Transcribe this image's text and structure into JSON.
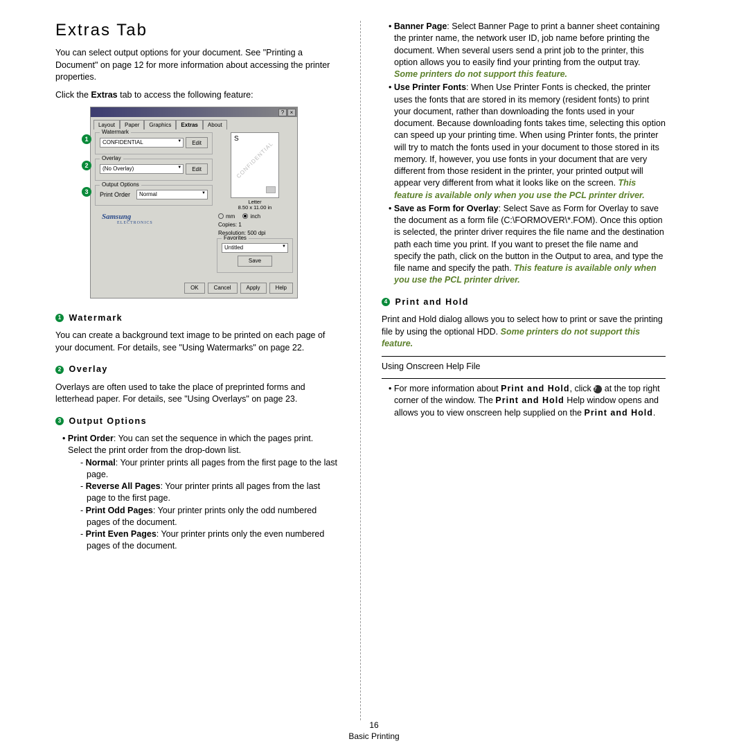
{
  "page": {
    "number": "16",
    "section": "Basic Printing"
  },
  "left": {
    "title": "Extras Tab",
    "intro": "You can select output options for your document. See \"Printing a Document\" on page 12 for more information about accessing the printer properties.",
    "click_line_pre": "Click the ",
    "click_line_bold": "Extras",
    "click_line_post": " tab to access the following feature:",
    "dialog": {
      "tabs": {
        "layout": "Layout",
        "paper": "Paper",
        "graphics": "Graphics",
        "extras": "Extras",
        "about": "About"
      },
      "watermark": {
        "legend": "Watermark",
        "value": "CONFIDENTIAL",
        "edit": "Edit"
      },
      "overlay": {
        "legend": "Overlay",
        "value": "(No Overlay)",
        "edit": "Edit"
      },
      "output": {
        "legend": "Output Options",
        "label": "Print Order",
        "value": "Normal"
      },
      "preview": {
        "wm": "CONFIDENTIAL",
        "s": "S",
        "label1": "Letter",
        "label2": "8.50 x 11.00 in"
      },
      "units": {
        "mm": "mm",
        "inch": "inch"
      },
      "info": {
        "copies": "Copies: 1",
        "res": "Resolution: 500 dpi"
      },
      "fav": {
        "legend": "Favorites",
        "value": "Untitled",
        "save": "Save"
      },
      "brand": "Samsung",
      "brand_sub": "ELECTRONICS",
      "buttons": {
        "ok": "OK",
        "cancel": "Cancel",
        "apply": "Apply",
        "help": "Help"
      },
      "titlebar": {
        "help": "?",
        "close": "×"
      }
    },
    "sect_watermark": {
      "num": "1",
      "label": "Watermark",
      "text": "You can create a background text image to be printed on each page of your document. For details, see \"Using Watermarks\" on page 22."
    },
    "sect_overlay": {
      "num": "2",
      "label": "Overlay",
      "text": "Overlays are often used to take the place of preprinted forms and letterhead paper. For details, see \"Using Overlays\" on page 23."
    },
    "sect_output": {
      "num": "3",
      "label": "Output Options",
      "b1_lead": "Print Order",
      "b1_rest": ": You can set the sequence in which the pages print. Select the print order from the drop-down list.",
      "d1_lead": "Normal",
      "d1_rest": ": Your printer prints all pages from the first page to the last page.",
      "d2_lead": "Reverse All Pages",
      "d2_rest": ": Your printer prints all pages from the last page to the first page.",
      "d3_lead": "Print Odd Pages",
      "d3_rest": ": Your printer prints only the odd numbered pages of the document.",
      "d4_lead": "Print Even Pages",
      "d4_rest": ": Your printer prints only the even numbered pages of the document."
    }
  },
  "right": {
    "banner": {
      "lead": "Banner Page",
      "rest": ": Select Banner Page to print a banner sheet containing the printer name, the network user ID, job name before printing the document. When several users send a print job to the printer, this option allows you to easily find your printing from the output tray. ",
      "note": "Some printers do not support this feature."
    },
    "fonts": {
      "lead": "Use Printer Fonts",
      "rest": ": When Use Printer Fonts is checked, the printer uses the fonts that are stored in its memory (resident fonts) to print your document, rather than downloading the fonts used in your document. Because downloading fonts takes time, selecting this option can speed up your printing time. When using Printer fonts, the printer will try to match the fonts used in your document to those stored in its memory. If, however, you use fonts in your document that are very different from those resident in the printer, your printed output will appear very different from what it looks like on the screen. ",
      "note": "This feature is available only when you use the PCL printer driver."
    },
    "saveas": {
      "lead": "Save as Form for Overlay",
      "rest": ": Select Save as Form for Overlay to save the document as a form file (C:\\FORMOVER\\*.FOM). Once this option is selected, the printer driver requires the file name and the destination path each time you print. If you want to preset the file name and specify the path, click on the button in the Output to area, and type the file name and specify the path. ",
      "note": "This feature is available only when you use the PCL printer driver."
    },
    "printhold": {
      "num": "4",
      "label": "Print and Hold",
      "text": "Print and Hold dialog allows you to select how to print or save the printing file by using the optional HDD. ",
      "note": "Some printers do not support this feature."
    },
    "help": {
      "heading": "Using Onscreen Help File",
      "b1_pre": "For more information about ",
      "b1_bold1": "Print and Hold",
      "b1_mid1": ", click ",
      "b1_qmark": "?",
      "b1_mid2": " at the top right corner of the window. The ",
      "b1_bold2": "Print and Hold",
      "b1_mid3": " Help window opens and allows you to view onscreen help supplied on the ",
      "b1_bold3": "Print and Hold",
      "b1_end": "."
    }
  }
}
